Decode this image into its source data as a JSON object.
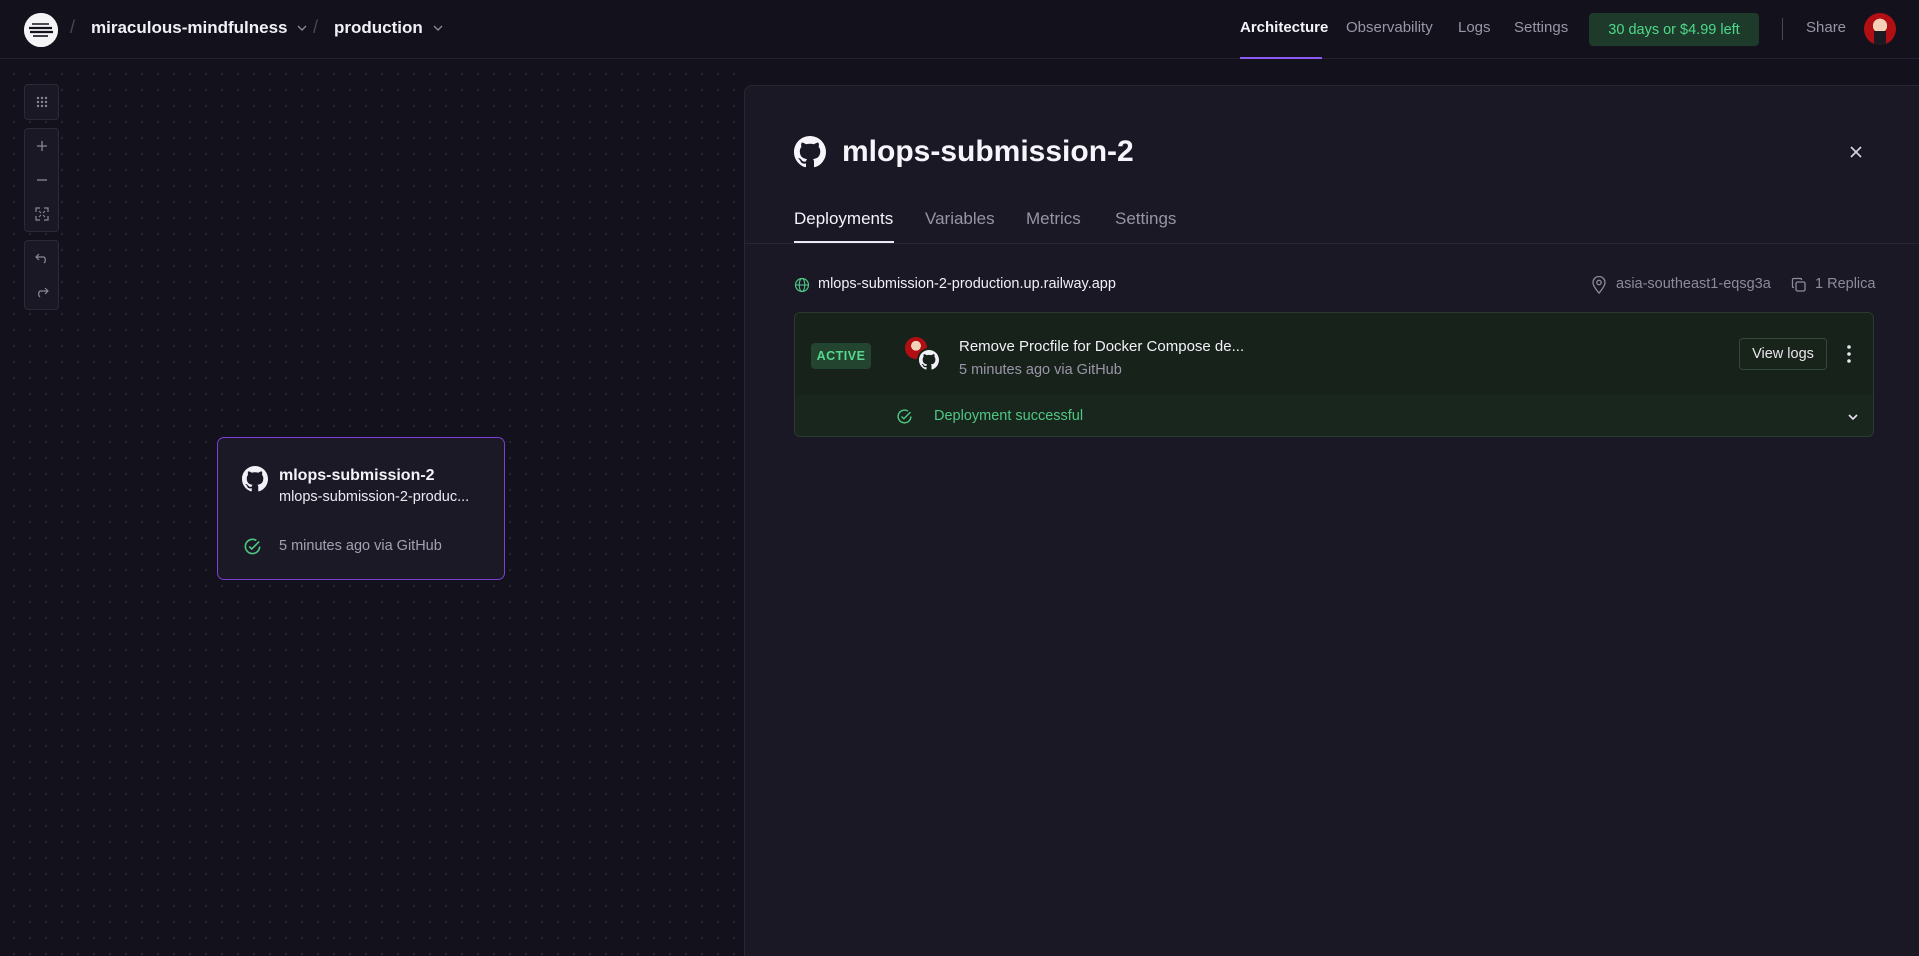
{
  "app": {
    "project_name": "miraculous-mindfulness",
    "environment": "production",
    "breadcrumb_sep": "/"
  },
  "nav": {
    "items": [
      {
        "label": "Architecture",
        "active": true
      },
      {
        "label": "Observability"
      },
      {
        "label": "Logs"
      },
      {
        "label": "Settings"
      }
    ],
    "trial_label": "30 days or $4.99 left",
    "share_label": "Share"
  },
  "canvas": {
    "service_card": {
      "title": "mlops-submission-2",
      "subtitle": "mlops-submission-2-produc...",
      "status": "5 minutes ago via GitHub"
    }
  },
  "panel": {
    "title": "mlops-submission-2",
    "tabs": [
      {
        "label": "Deployments",
        "active": true
      },
      {
        "label": "Variables"
      },
      {
        "label": "Metrics"
      },
      {
        "label": "Settings"
      }
    ],
    "domain": "mlops-submission-2-production.up.railway.app",
    "region": "asia-southeast1-eqsg3a",
    "replicas": "1 Replica",
    "deployment": {
      "badge": "ACTIVE",
      "commit_message": "Remove Procfile for Docker Compose de...",
      "meta": "5 minutes ago via GitHub",
      "view_logs_label": "View logs",
      "status": "Deployment successful"
    }
  },
  "colors": {
    "accent": "#8c5cf5",
    "success": "#4fd98a",
    "background": "#13111c"
  }
}
